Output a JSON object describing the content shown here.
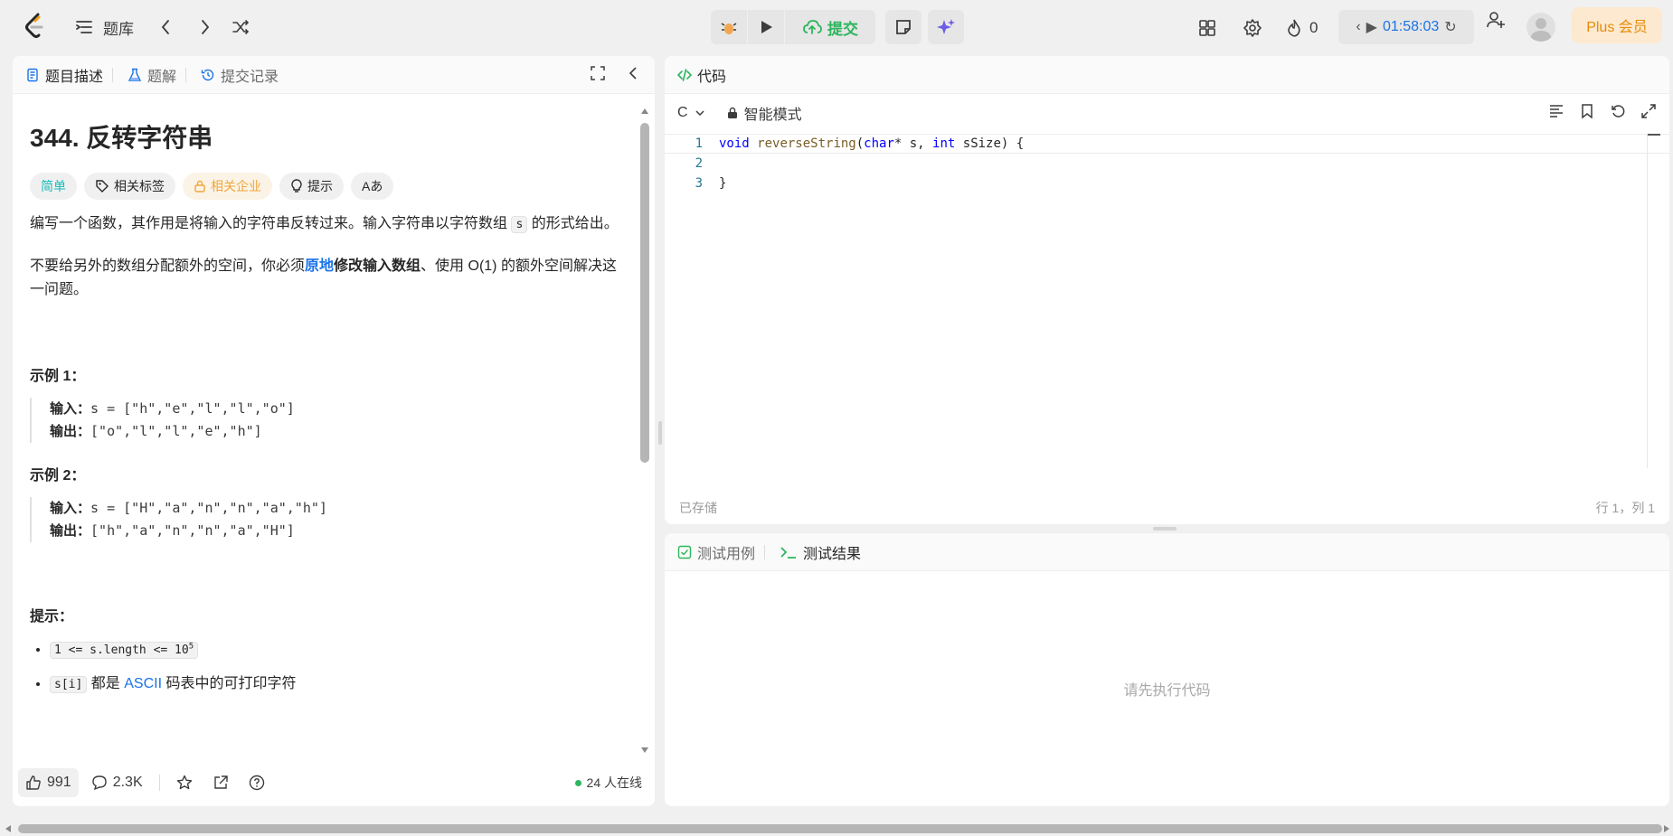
{
  "colors": {
    "accent": "#1a73e8",
    "submit": "#2db55d",
    "easy": "#15bdba",
    "plus": "#e58c0a"
  },
  "topbar": {
    "problem_list_label": "题库",
    "submit_label": "提交",
    "streak_count": "0",
    "timer": "01:58:03",
    "plus_label": "Plus 会员"
  },
  "left": {
    "tabs": [
      "题目描述",
      "题解",
      "提交记录"
    ],
    "title": "344. 反转字符串",
    "tags": [
      "简单",
      "相关标签",
      "相关企业",
      "提示",
      "Aあ"
    ],
    "desc1_pre": "编写一个函数，其作用是将输入的字符串反转过来。输入字符串以字符数组 ",
    "desc1_code": "s",
    "desc1_post": " 的形式给出。",
    "desc2_pre": "不要给另外的数组分配额外的空间，你必须",
    "desc2_link": "原地",
    "desc2_bold": "修改输入数组",
    "desc2_post": "、使用 O(1) 的额外空间解决这一问题。",
    "example1_title": "示例 1：",
    "example1_input_label": "输入：",
    "example1_input": "s = [\"h\",\"e\",\"l\",\"l\",\"o\"]",
    "example1_output_label": "输出：",
    "example1_output": "[\"o\",\"l\",\"l\",\"e\",\"h\"]",
    "example2_title": "示例 2：",
    "example2_input_label": "输入：",
    "example2_input": "s = [\"H\",\"a\",\"n\",\"n\",\"a\",\"h\"]",
    "example2_output_label": "输出：",
    "example2_output": "[\"h\",\"a\",\"n\",\"n\",\"a\",\"H\"]",
    "hints_title": "提示：",
    "hint1_code": "1 <= s.length <= 10",
    "hint1_sup": "5",
    "hint2_code": "s[i]",
    "hint2_mid": " 都是 ",
    "hint2_link": "ASCII",
    "hint2_post": " 码表中的可打印字符",
    "footer": {
      "likes": "991",
      "comments": "2.3K",
      "online": "24 人在线"
    }
  },
  "code": {
    "header": "代码",
    "language": "C",
    "mode": "智能模式",
    "lines": [
      {
        "num": "1",
        "text": "void reverseString(char* s, int sSize) {"
      },
      {
        "num": "2",
        "text": ""
      },
      {
        "num": "3",
        "text": "}"
      }
    ],
    "saved": "已存储",
    "cursor": "行 1，列 1"
  },
  "test": {
    "tabs": [
      "测试用例",
      "测试结果"
    ],
    "empty": "请先执行代码"
  }
}
